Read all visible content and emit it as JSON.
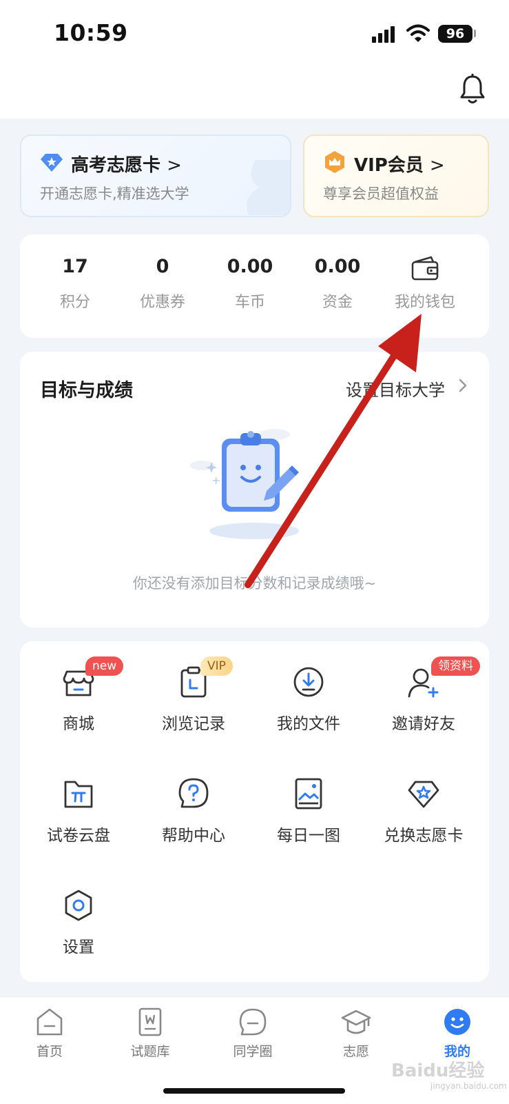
{
  "status_bar": {
    "time": "10:59",
    "battery": "96"
  },
  "promo_cards": [
    {
      "title": "高考志愿卡",
      "subtitle": "开通志愿卡,精准选大学"
    },
    {
      "title": "VIP会员",
      "subtitle": "尊享会员超值权益"
    }
  ],
  "stats": [
    {
      "value": "17",
      "label": "积分"
    },
    {
      "value": "0",
      "label": "优惠券"
    },
    {
      "value": "0.00",
      "label": "车币"
    },
    {
      "value": "0.00",
      "label": "资金"
    },
    {
      "label": "我的钱包"
    }
  ],
  "goals": {
    "title": "目标与成绩",
    "link": "设置目标大学",
    "empty_text": "你还没有添加目标分数和记录成绩哦~"
  },
  "menu": [
    {
      "label": "商城",
      "badge": "new"
    },
    {
      "label": "浏览记录",
      "badge": "VIP"
    },
    {
      "label": "我的文件"
    },
    {
      "label": "邀请好友",
      "badge": "领资料"
    },
    {
      "label": "试卷云盘"
    },
    {
      "label": "帮助中心"
    },
    {
      "label": "每日一图"
    },
    {
      "label": "兑换志愿卡"
    },
    {
      "label": "设置"
    }
  ],
  "tabs": [
    {
      "label": "首页"
    },
    {
      "label": "试题库"
    },
    {
      "label": "同学圈"
    },
    {
      "label": "志愿"
    },
    {
      "label": "我的"
    }
  ],
  "colors": {
    "accent": "#2f7bf2",
    "badge_red": "#f05151",
    "annotation_arrow": "#c8211b"
  },
  "watermark": {
    "brand": "Baidu经验",
    "site": "jingyan.baidu.com"
  }
}
